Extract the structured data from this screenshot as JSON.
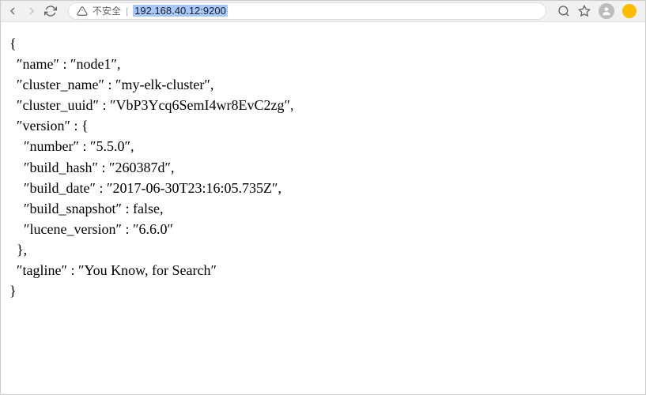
{
  "toolbar": {
    "security_label": "不安全",
    "url": "192.168.40.12:9200"
  },
  "response": {
    "name": "node1",
    "cluster_name": "my-elk-cluster",
    "cluster_uuid": "VbP3Ycq6SemI4wr8EvC2zg",
    "version": {
      "number": "5.5.0",
      "build_hash": "260387d",
      "build_date": "2017-06-30T23:16:05.735Z",
      "build_snapshot": "false",
      "lucene_version": "6.6.0"
    },
    "tagline": "You Know, for Search"
  }
}
